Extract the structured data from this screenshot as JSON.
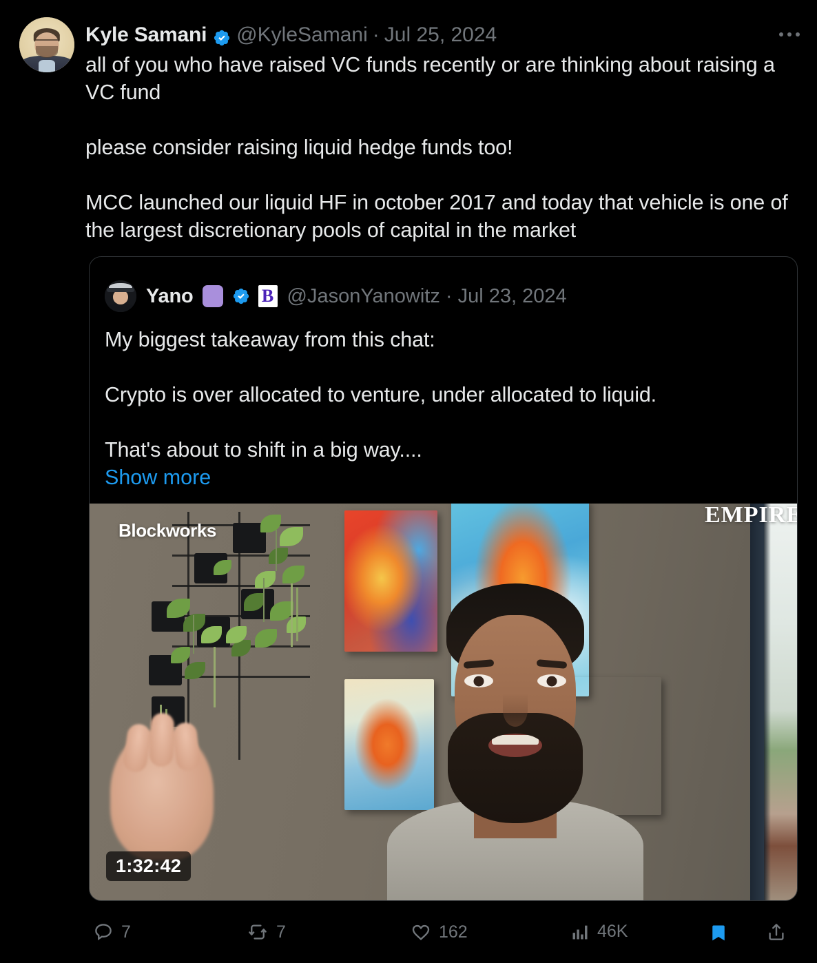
{
  "tweet": {
    "author": {
      "display_name": "Kyle Samani",
      "handle": "@KyleSamani",
      "verified_badge": "verified-badge-icon",
      "avatar": "kyle-samani-avatar"
    },
    "separator": "·",
    "date": "Jul 25, 2024",
    "more_menu": "more-options-icon",
    "text": "all of you who have raised VC funds recently or are thinking about raising a VC fund\n\nplease consider raising liquid hedge funds too!\n\nMCC launched our liquid HF in october 2017 and today that vehicle is one of the largest discretionary pools of capital in the market"
  },
  "quoted_tweet": {
    "author": {
      "display_name": "Yano",
      "handle": "@JasonYanowitz",
      "emoji_badge": "purple-square-emoji",
      "verified_badge": "verified-badge-icon",
      "affiliate_badge_letter": "B",
      "affiliate_badge": "blockworks-affiliate-icon",
      "avatar": "jason-yanowitz-avatar"
    },
    "separator": "·",
    "date": "Jul 23, 2024",
    "text": "My biggest takeaway from this chat:\n\nCrypto is over allocated to venture, under allocated to liquid.\n\nThat's about to shift in a big way....",
    "show_more_label": "Show more",
    "media": {
      "type": "video",
      "watermark_left": "Blockworks",
      "watermark_right": "EMPIRE",
      "duration": "1:32:42",
      "description": "man speaking on camera in front of a gray wall with colorful phoenix paintings and wall-mounted trailing plants"
    }
  },
  "actions": {
    "reply": {
      "icon": "reply-icon",
      "count": "7"
    },
    "retweet": {
      "icon": "retweet-icon",
      "count": "7"
    },
    "like": {
      "icon": "heart-icon",
      "count": "162"
    },
    "views": {
      "icon": "views-bar-chart-icon",
      "count": "46K"
    },
    "bookmark": {
      "icon": "bookmark-filled-icon",
      "state": "saved"
    },
    "share": {
      "icon": "share-upload-icon"
    }
  },
  "colors": {
    "background": "#000000",
    "text_primary": "#e7e9ea",
    "text_secondary": "#71767b",
    "accent_blue": "#1d9bf0",
    "border": "#2f3336",
    "emoji_purple": "#a98fdc",
    "badge_purple": "#4b22b8"
  }
}
